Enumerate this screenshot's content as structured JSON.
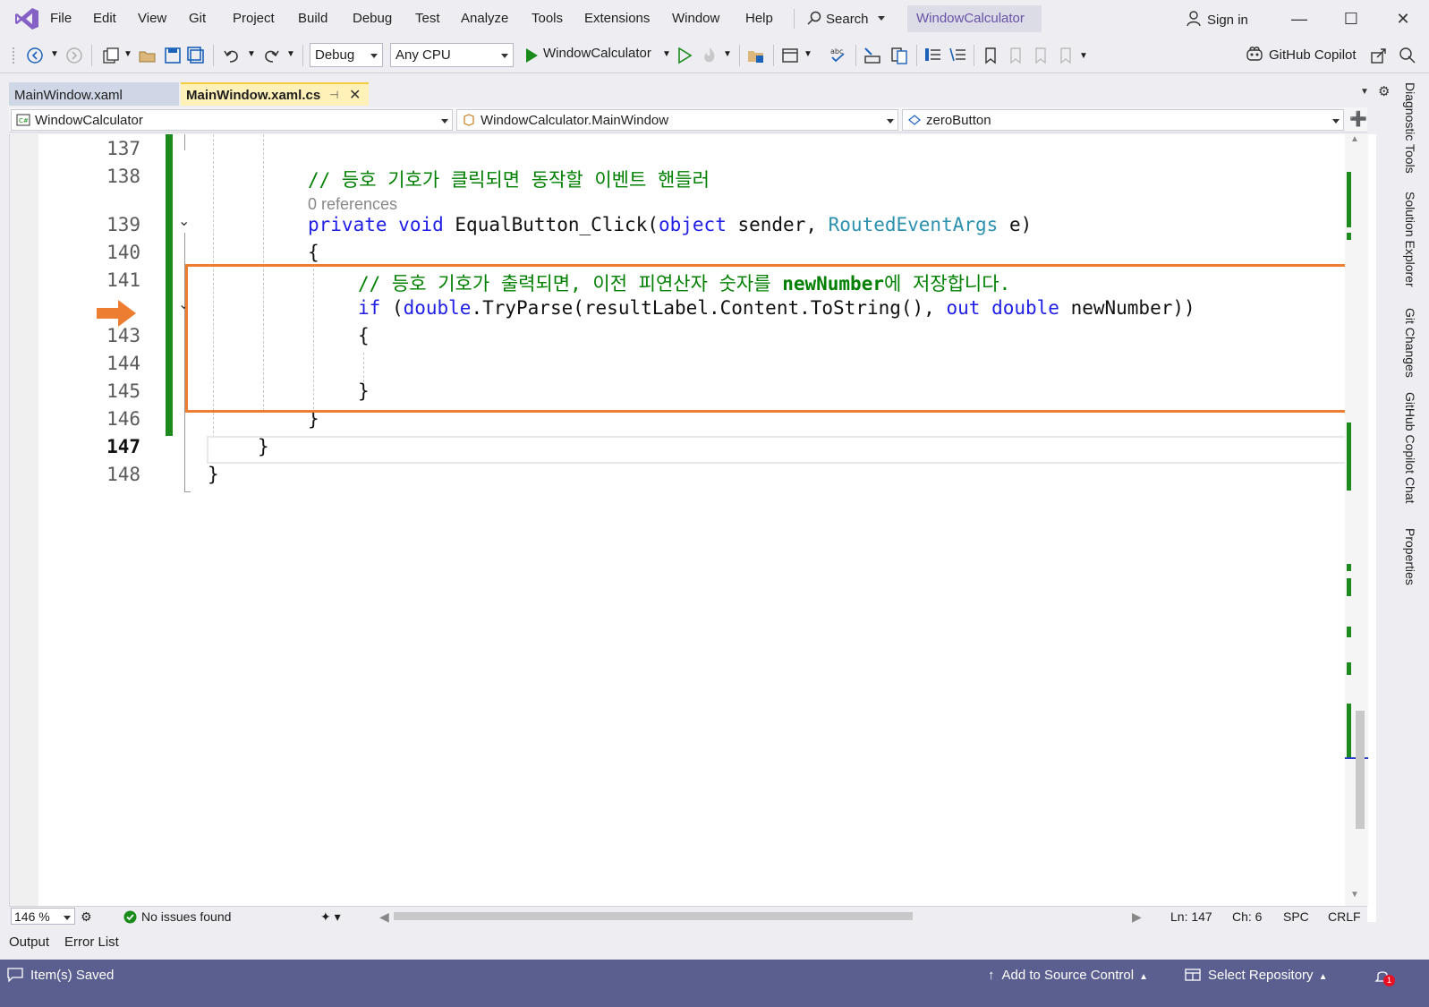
{
  "menu": {
    "items": [
      "File",
      "Edit",
      "View",
      "Git",
      "Project",
      "Build",
      "Debug",
      "Test",
      "Analyze",
      "Tools",
      "Extensions",
      "Window",
      "Help"
    ],
    "search_label": "Search",
    "solution_title": "WindowCalculator",
    "sign_in": "Sign in"
  },
  "toolbar": {
    "configuration": "Debug",
    "platform": "Any CPU",
    "start_target": "WindowCalculator",
    "copilot": "GitHub Copilot"
  },
  "tabs": [
    {
      "label": "MainWindow.xaml",
      "active": false
    },
    {
      "label": "MainWindow.xaml.cs",
      "active": true
    }
  ],
  "nav": {
    "project": "WindowCalculator",
    "type": "WindowCalculator.MainWindow",
    "member": "zeroButton"
  },
  "code": {
    "lines": [
      {
        "num": "137"
      },
      {
        "num": "138",
        "comment": "// 등호 기호가 클릭되면 동작할 이벤트 핸들러"
      },
      {
        "num": "139"
      },
      {
        "num": "140",
        "text": "{"
      },
      {
        "num": "141",
        "comment": "// 등호 기호가 출력되면, 이전 피연산자 숫자를 ",
        "comment_var": "newNumber",
        "comment_tail": "에 저장합니다."
      },
      {
        "num": "142"
      },
      {
        "num": "143",
        "text": "{"
      },
      {
        "num": "144"
      },
      {
        "num": "145",
        "text": "}"
      },
      {
        "num": "146",
        "text": "}"
      },
      {
        "num": "147",
        "text": "}"
      },
      {
        "num": "148",
        "text": "}"
      }
    ],
    "references": "0 references",
    "line139": {
      "kw1": "private",
      "kw2": "void",
      "name": "EqualButton_Click(",
      "kw3": "object",
      "arg1": " sender, ",
      "type": "RoutedEventArgs",
      "arg2": " e)"
    },
    "line142": {
      "kw1": "if",
      "p1": " (",
      "kw2": "double",
      "call": ".TryParse(resultLabel.Content.ToString(), ",
      "kw3": "out",
      "sp": " ",
      "kw4": "double",
      "var": " newNumber))"
    }
  },
  "editor_status": {
    "zoom": "146 %",
    "issues": "No issues found",
    "line": "Ln: 147",
    "col": "Ch: 6",
    "spacing": "SPC",
    "eol": "CRLF"
  },
  "bottom_tabs": [
    "Output",
    "Error List"
  ],
  "statusbar": {
    "message": "Item(s) Saved",
    "source_control": "Add to Source Control",
    "repository": "Select Repository",
    "notification_count": "1"
  },
  "side_tabs": [
    "Diagnostic Tools",
    "Solution Explorer",
    "Git Changes",
    "GitHub Copilot Chat",
    "Properties"
  ],
  "colors": {
    "accent": "#5b5f8f",
    "highlight_box": "#ed7d31",
    "change_bar": "#1d8a1d",
    "keyword": "#1e1ee6",
    "type": "#2b91af",
    "comment": "#008000"
  }
}
